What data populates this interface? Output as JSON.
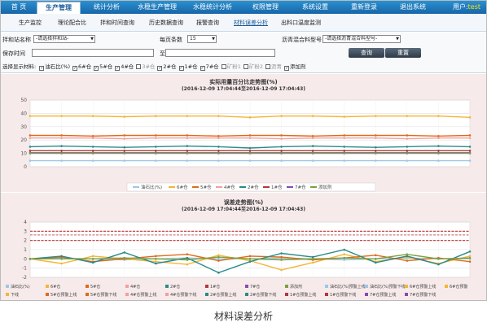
{
  "nav": {
    "items": [
      "首 页",
      "生产管理",
      "统计分析",
      "水稳生产管理",
      "水稳统计分析",
      "权限管理",
      "系统设置",
      "重新登录",
      "退出系统"
    ],
    "active_index": 1,
    "user_label": "用户:",
    "user_name": "test"
  },
  "subnav": {
    "items": [
      "生产监控",
      "理论配合比",
      "拌和时间查询",
      "历史数据查询",
      "报警查询",
      "材料误差分析",
      "出料口温度监测"
    ],
    "active_index": 5
  },
  "filters": {
    "station_label": "拌和站名称",
    "station_value": "-请选择拌和站-",
    "per_page_label": "每页条数",
    "per_page_value": "15",
    "mix_label": "沥青混合料型号",
    "mix_value": "-请选择沥青混合料型号-",
    "save_time_label": "保存时间",
    "save_time_value": "",
    "to_label": "至",
    "to_value": "",
    "query_button": "查询",
    "reset_button": "重置",
    "display_label": "选择显示材料:",
    "materials": [
      {
        "name": "油石比(%)",
        "checked": true
      },
      {
        "name": "6#仓",
        "checked": true
      },
      {
        "name": "5#仓",
        "checked": true
      },
      {
        "name": "4#仓",
        "checked": true
      },
      {
        "name": "3#仓",
        "checked": false
      },
      {
        "name": "2#仓",
        "checked": true
      },
      {
        "name": "1#仓",
        "checked": true
      },
      {
        "name": "7#仓",
        "checked": true
      },
      {
        "name": "矿粉1",
        "checked": false
      },
      {
        "name": "矿粉2",
        "checked": false
      },
      {
        "name": "沥青",
        "checked": false
      },
      {
        "name": "添加剂",
        "checked": true
      }
    ]
  },
  "chart_data": [
    {
      "type": "line",
      "title": "实际用量百分比走势图(%)",
      "subtitle": "(2016-12-09 17:04:44至2016-12-09 17:04:43)",
      "ylim": [
        0,
        50
      ],
      "yticks": [
        0,
        10,
        20,
        30,
        40,
        50
      ],
      "x_count": 15,
      "grid": true,
      "legend_position": "bottom",
      "series": [
        {
          "name": "油石比(%)",
          "color": "#9ec6e8",
          "values": [
            4.5,
            4.5,
            4.5,
            4.5,
            4.5,
            4.5,
            4.5,
            4.5,
            4.5,
            4.5,
            4.5,
            4.5,
            4.5,
            4.5,
            4.5
          ]
        },
        {
          "name": "6#仓",
          "color": "#f2b63a",
          "values": [
            38,
            38,
            38,
            37.5,
            38,
            38,
            38,
            37,
            38,
            38,
            37.5,
            38,
            38,
            38,
            37
          ]
        },
        {
          "name": "5#仓",
          "color": "#e06a1a",
          "values": [
            23.5,
            23.5,
            23,
            23.5,
            23.5,
            23.5,
            23,
            23.5,
            23.5,
            23,
            23.5,
            23.5,
            23.5,
            23,
            23.5
          ]
        },
        {
          "name": "4#仓",
          "color": "#f0a0a0",
          "values": [
            21.5,
            21.5,
            21.5,
            21,
            21.5,
            21.5,
            21.5,
            21.5,
            21,
            21.5,
            21.5,
            21.5,
            21,
            21.5,
            21.5
          ]
        },
        {
          "name": "2#仓",
          "color": "#2a8a8a",
          "values": [
            15,
            15.5,
            15,
            14.5,
            15,
            15.5,
            15,
            14,
            15,
            15.5,
            15,
            14.5,
            15,
            15.5,
            15
          ]
        },
        {
          "name": "1#仓",
          "color": "#b03a3a",
          "values": [
            12,
            12,
            12,
            12,
            12,
            12,
            12,
            12,
            12,
            12,
            12,
            12,
            12,
            12,
            12
          ]
        },
        {
          "name": "7#仓",
          "color": "#8a4ab0",
          "values": [
            10.5,
            10.5,
            10.5,
            10.5,
            10.5,
            10.5,
            10.5,
            10.5,
            10.5,
            10.5,
            10.5,
            10.5,
            10.5,
            10.5,
            10.5
          ]
        },
        {
          "name": "添加剂",
          "color": "#7aa040",
          "values": [
            10,
            10,
            10,
            10,
            10,
            10,
            10,
            10,
            10,
            10,
            10,
            10,
            10,
            10,
            10
          ]
        }
      ]
    },
    {
      "type": "line",
      "title": "误差走势图(%)",
      "subtitle": "(2016-12-09 17:04:44至2016-12-09 17:04:43)",
      "ylim": [
        -2,
        4
      ],
      "yticks": [
        -2,
        -1,
        0,
        1,
        2,
        3,
        4
      ],
      "x_count": 15,
      "grid": true,
      "legend_position": "bottom",
      "thresholds": [
        {
          "value": 3,
          "color": "#c03030"
        },
        {
          "value": 2.6,
          "color": "#d08080"
        },
        {
          "value": 2,
          "color": "#c03030"
        }
      ],
      "series": [
        {
          "name": "油石比(%)",
          "color": "#9ec6e8",
          "values": [
            0,
            0.1,
            0,
            -0.1,
            0,
            0.1,
            0,
            0,
            0.1,
            0,
            -0.1,
            0,
            0.1,
            0,
            0
          ]
        },
        {
          "name": "6#仓",
          "color": "#f2b63a",
          "values": [
            0,
            -0.5,
            0.3,
            0,
            -0.3,
            -0.6,
            0.4,
            -0.2,
            -1.2,
            -0.4,
            0.5,
            -0.3,
            0.2,
            -0.5,
            0.3
          ]
        },
        {
          "name": "5#仓",
          "color": "#e06a1a",
          "values": [
            0,
            0.2,
            -0.3,
            0,
            0.3,
            0.5,
            -0.2,
            0.3,
            0.2,
            -0.1,
            0.1,
            0.4,
            -0.2,
            0.1,
            -0.3
          ]
        },
        {
          "name": "2#仓",
          "color": "#2a8a8a",
          "values": [
            0,
            0.3,
            -0.4,
            0.7,
            -0.5,
            0.1,
            -1.5,
            -0.3,
            0.6,
            0.2,
            1.0,
            -0.4,
            0.3,
            -0.6,
            0.8
          ]
        },
        {
          "name": "添加剂",
          "color": "#7aa040",
          "values": [
            0,
            0,
            0,
            0.1,
            0,
            -0.1,
            0.2,
            0,
            -0.1,
            0,
            0.1,
            0,
            0.5,
            0,
            0.1
          ]
        }
      ]
    }
  ],
  "bottom_legend": [
    "油石比(%)",
    "6#仓",
    "5#仓",
    "4#仓",
    "2#仓",
    "1#仓",
    "7#仓",
    "添加剂",
    "油石比(%)预警上线",
    "油石比(%)预警下线",
    "6#仓预警上线",
    "6#仓预警",
    "下线",
    "5#仓预警上线",
    "5#仓预警下线",
    "4#仓预警上线",
    "4#仓预警下线",
    "2#仓预警上线",
    "2#仓预警下线",
    "1#仓预警上线",
    "1#仓预警下线",
    "7#仓预警上线",
    "7#仓预警下线"
  ],
  "caption": "材料误差分析"
}
